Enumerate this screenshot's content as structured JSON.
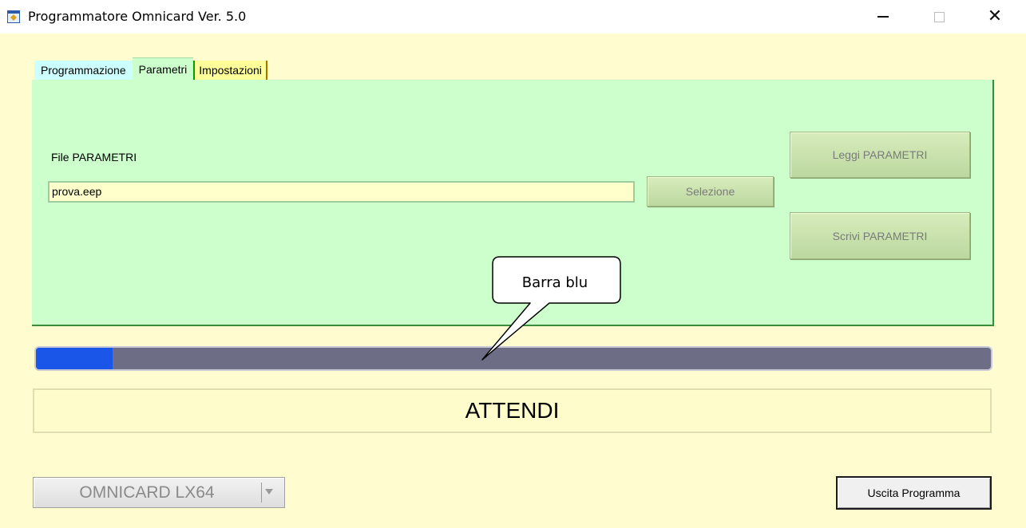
{
  "window": {
    "title": "Programmatore Omnicard Ver. 5.0",
    "app_icon": "app-icon",
    "controls": {
      "minimize_icon": "minimize-icon",
      "maximize_icon": "maximize-icon",
      "close_glyph": "✕"
    }
  },
  "tabs": [
    {
      "label": "Programmazione",
      "color": "#ccffff"
    },
    {
      "label": "Parametri",
      "color": "#ccffcc",
      "active": true
    },
    {
      "label": "Impostazioni",
      "color": "#ffff99"
    }
  ],
  "panel": {
    "file_label": "File PARAMETRI",
    "file_value": "prova.eep",
    "select_button": "Selezione",
    "read_button": "Leggi PARAMETRI",
    "write_button": "Scrivi PARAMETRI",
    "background": "#ccffcc"
  },
  "progress": {
    "value": 0.08,
    "fill_color": "#1a56e8",
    "track_color": "#6d6d86"
  },
  "annotation": {
    "text": "Barra blu"
  },
  "status": {
    "text": "ATTENDI"
  },
  "model_select": {
    "value": "OMNICARD LX64",
    "arrow_icon": "chevron-down-icon"
  },
  "exit_button": {
    "label": "Uscita Programma"
  },
  "colors": {
    "client_background": "#fffdd0"
  }
}
